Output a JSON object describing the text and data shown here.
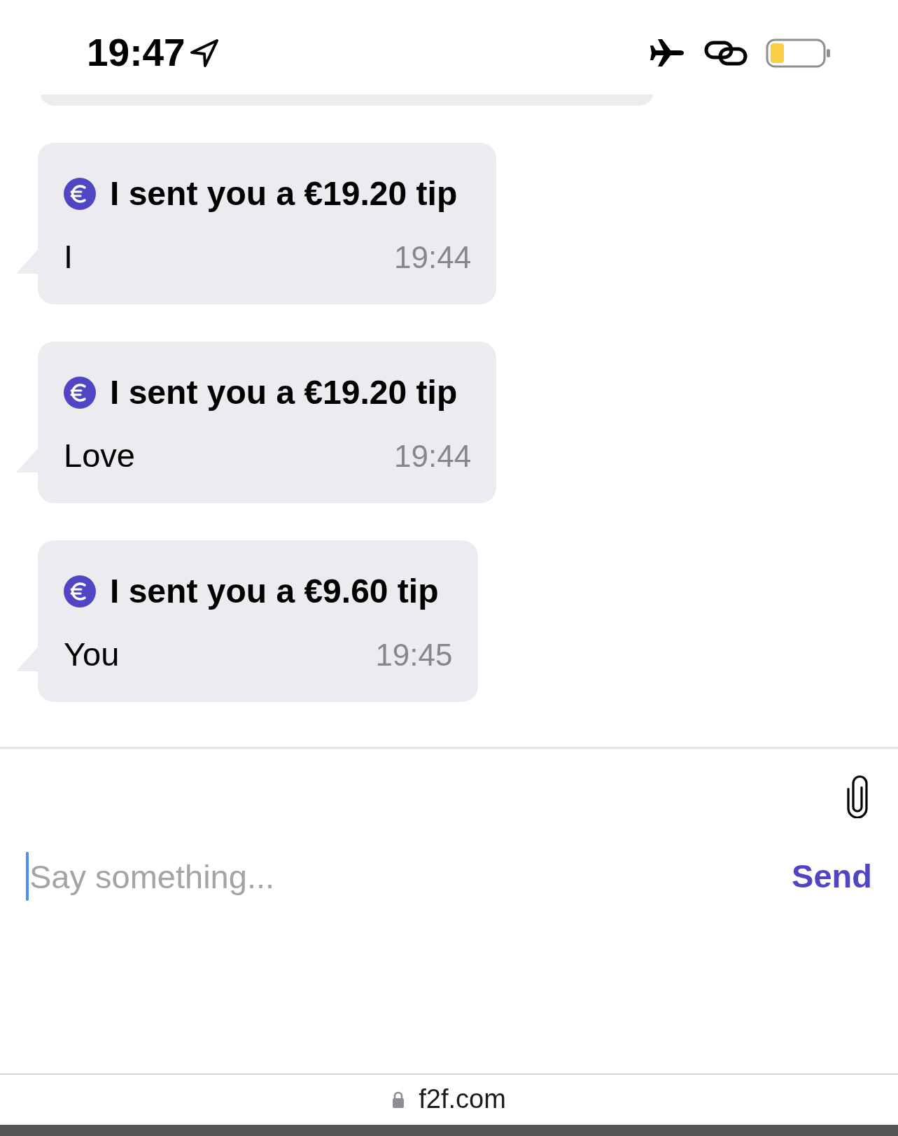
{
  "status_bar": {
    "time": "19:47"
  },
  "messages": [
    {
      "title": "I sent you a €19.20 tip",
      "text": "I",
      "time": "19:44"
    },
    {
      "title": "I sent you a €19.20 tip",
      "text": "Love",
      "time": "19:44"
    },
    {
      "title": "I sent you a €9.60 tip",
      "text": "You",
      "time": "19:45"
    }
  ],
  "composer": {
    "placeholder": "Say something...",
    "focused": true,
    "send_label": "Send"
  },
  "address_bar": {
    "url": "f2f.com"
  }
}
